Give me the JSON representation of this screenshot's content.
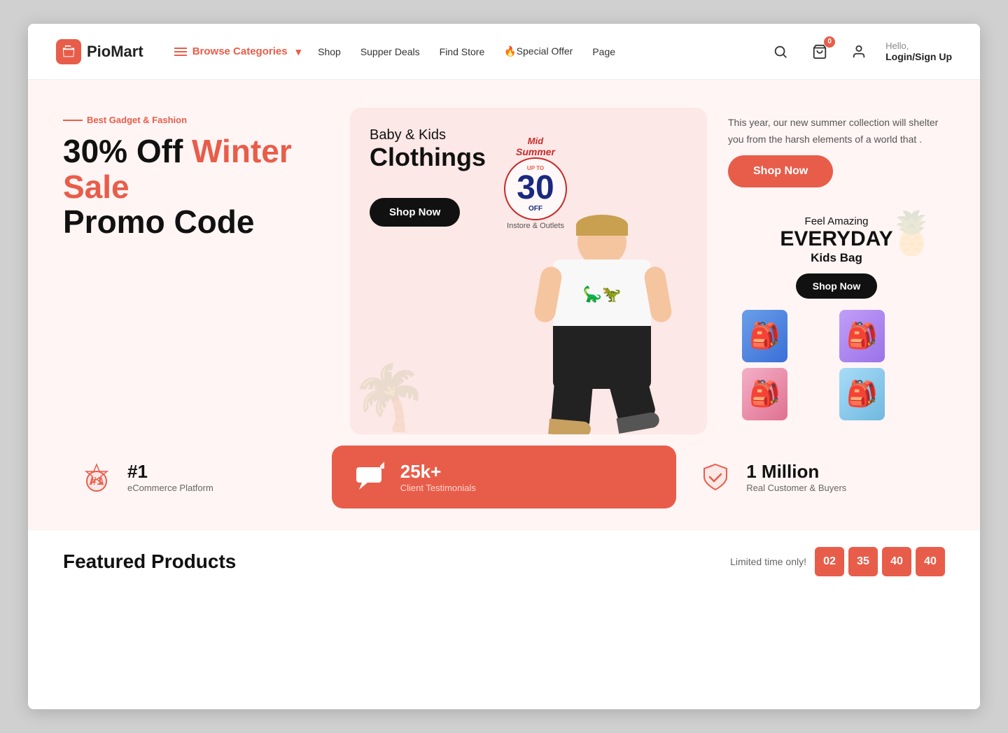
{
  "header": {
    "logo_text": "PioMart",
    "browse_label": "Browse Categories",
    "nav": [
      {
        "label": "Shop"
      },
      {
        "label": "Supper Deals"
      },
      {
        "label": "Find Store"
      },
      {
        "label": "🔥Special Offer"
      },
      {
        "label": "Page"
      }
    ],
    "cart_badge": "0",
    "hello_text": "Hello,",
    "login_label": "Login/Sign Up"
  },
  "hero": {
    "best_tag": "Best Gadget & Fashion",
    "title_black1": "30% Off",
    "title_red": "Winter Sale",
    "title_black2": "Promo Code",
    "description": "This year, our new summer collection will shelter you from the harsh elements of a world that .",
    "shop_now_red": "Shop Now",
    "banner": {
      "sub": "Baby & Kids",
      "main": "Clothings",
      "shop_btn": "Shop Now",
      "badge_label": "Mid",
      "badge_sub": "Summer",
      "badge_number": "30",
      "badge_upto": "UP TO",
      "badge_off": "OFF",
      "badge_desc": "Instore & Outlets"
    },
    "everyday": {
      "feel": "Feel Amazing",
      "title": "EVERYDAY",
      "subtitle": "Kids Bag",
      "shop_btn": "Shop Now"
    }
  },
  "stats": [
    {
      "number": "#1",
      "label": "eCommerce Platform",
      "icon": "medal"
    },
    {
      "number": "25k+",
      "label": "Client Testimonials",
      "icon": "testimonial",
      "highlight": true
    },
    {
      "number": "1 Million",
      "label": "Real Customer & Buyers",
      "icon": "shield-check"
    }
  ],
  "featured": {
    "title": "Featured Products",
    "timer_label": "Limited time only!",
    "timer": [
      "02",
      "35",
      "40",
      "40"
    ]
  }
}
